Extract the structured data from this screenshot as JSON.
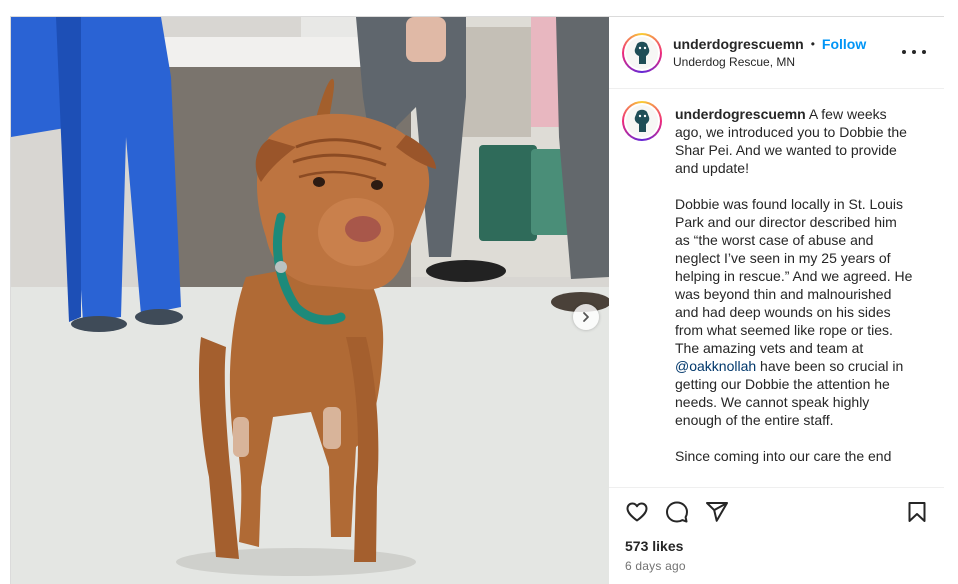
{
  "post": {
    "username": "underdogrescuemn",
    "follow_label": "Follow",
    "separator": "•",
    "location": "Underdog Rescue, MN",
    "caption_paragraphs": [
      "A few weeks ago, we introduced you to Dobbie the Shar Pei. And we wanted to provide and update!",
      "Dobbie was found locally in St. Louis Park and our director described him as “the worst case of abuse and neglect I’ve seen in my 25 years of helping in rescue.” And we agreed. He was beyond thin and malnourished and had deep wounds on his sides from what seemed like rope or ties. The amazing vets and team at ",
      "Since coming into our care the end"
    ],
    "mention": "@oakknollah",
    "caption_after_mention": " have been so crucial in getting our Dobbie the attention he needs. We cannot speak highly enough of the entire staff.",
    "likes": "573 likes",
    "time_ago": "6 days ago"
  },
  "icons": {
    "like": "heart-icon",
    "comment": "comment-icon",
    "share": "send-icon",
    "save": "bookmark-icon",
    "more": "more-options-icon",
    "next": "chevron-right-icon"
  },
  "colors": {
    "follow": "#0095f6",
    "mention": "#00376b",
    "muted": "#737373",
    "text": "#262626"
  }
}
